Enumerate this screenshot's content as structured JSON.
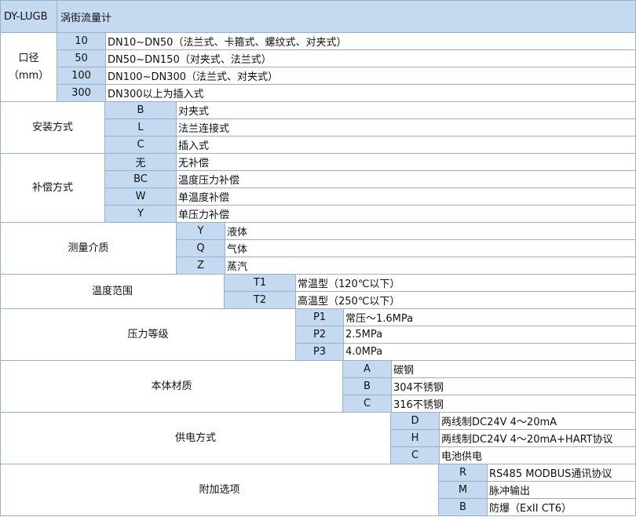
{
  "header": {
    "model": "DY-LUGB",
    "title": "涡街流量计"
  },
  "sections": [
    {
      "category": [
        "口径",
        "（mm）"
      ],
      "rows": [
        {
          "code": "10",
          "desc": "DN10~DN50（法兰式、卡箍式、螺纹式、对夹式）"
        },
        {
          "code": "50",
          "desc": "DN50~DN150（对夹式、法兰式）"
        },
        {
          "code": "100",
          "desc": "DN100~DN300（法兰式、对夹式）"
        },
        {
          "code": "300",
          "desc": "DN300以上为插入式"
        }
      ]
    },
    {
      "category": [
        "安装方式"
      ],
      "rows": [
        {
          "code": "B",
          "desc": "对夹式"
        },
        {
          "code": "L",
          "desc": "法兰连接式"
        },
        {
          "code": "C",
          "desc": "插入式"
        }
      ]
    },
    {
      "category": [
        "补偿方式"
      ],
      "rows": [
        {
          "code": "无",
          "desc": "无补偿"
        },
        {
          "code": "BC",
          "desc": "温度压力补偿"
        },
        {
          "code": "W",
          "desc": "单温度补偿"
        },
        {
          "code": "Y",
          "desc": "单压力补偿"
        }
      ]
    },
    {
      "category": [
        "测量介质"
      ],
      "rows": [
        {
          "code": "Y",
          "desc": "液体"
        },
        {
          "code": "Q",
          "desc": "气体"
        },
        {
          "code": "Z",
          "desc": "蒸汽"
        }
      ]
    },
    {
      "category": [
        "温度范围"
      ],
      "rows": [
        {
          "code": "T1",
          "desc": "常温型（120℃以下）"
        },
        {
          "code": "T2",
          "desc": "高温型（250℃以下）"
        }
      ]
    },
    {
      "category": [
        "压力等级"
      ],
      "rows": [
        {
          "code": "P1",
          "desc": "常压～1.6MPa"
        },
        {
          "code": "P2",
          "desc": "2.5MPa"
        },
        {
          "code": "P3",
          "desc": "4.0MPa"
        }
      ]
    },
    {
      "category": [
        "本体材质"
      ],
      "rows": [
        {
          "code": "A",
          "desc": "碳钢"
        },
        {
          "code": "B",
          "desc": "304不锈钢"
        },
        {
          "code": "C",
          "desc": "316不锈钢"
        }
      ]
    },
    {
      "category": [
        "供电方式"
      ],
      "rows": [
        {
          "code": "D",
          "desc": "两线制DC24V  4～20mA"
        },
        {
          "code": "H",
          "desc": "两线制DC24V  4～20mA+HART协议"
        },
        {
          "code": "C",
          "desc": "电池供电"
        }
      ]
    },
    {
      "category": [
        "附加选项"
      ],
      "rows": [
        {
          "code": "R",
          "desc": "RS485 MODBUS通讯协议"
        },
        {
          "code": "M",
          "desc": "脉冲输出"
        },
        {
          "code": "B",
          "desc": "防爆（ExII CT6）"
        }
      ]
    }
  ]
}
